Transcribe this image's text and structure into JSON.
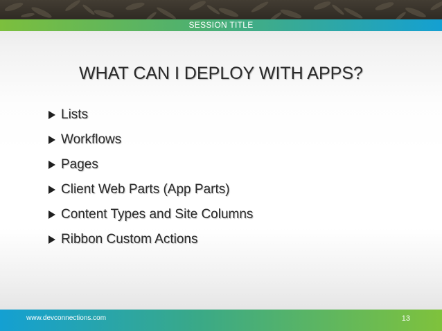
{
  "header": {
    "session_title": "SESSION TITLE"
  },
  "slide": {
    "title": "WHAT CAN I DEPLOY WITH APPS?",
    "bullets": [
      "Lists",
      "Workflows",
      "Pages",
      "Client Web Parts (App Parts)",
      "Content Types and Site Columns",
      "Ribbon Custom Actions"
    ]
  },
  "footer": {
    "url": "www.devconnections.com",
    "page_number": "13"
  },
  "colors": {
    "header_band": "#3a342c",
    "bar_green": "#7cbf3d",
    "bar_blue": "#14a0d2",
    "text": "#2a2a2a"
  }
}
